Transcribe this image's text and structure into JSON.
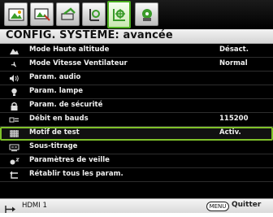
{
  "tabs": [
    {
      "icon": "image-tab-icon",
      "active": false
    },
    {
      "icon": "display-tab-icon",
      "active": false
    },
    {
      "icon": "settings-basic-tab-icon",
      "active": false
    },
    {
      "icon": "system-basic-tab-icon",
      "active": false
    },
    {
      "icon": "system-advanced-tab-icon",
      "active": true
    },
    {
      "icon": "information-tab-icon",
      "active": false
    }
  ],
  "header": {
    "title": "CONFIG. SYSTÈME: avancée"
  },
  "menu": {
    "items": [
      {
        "icon": "altitude-icon",
        "label": "Mode Haute altitude",
        "value": "Désact."
      },
      {
        "icon": "fan-icon",
        "label": "Mode Vitesse Ventilateur",
        "value": "Normal"
      },
      {
        "icon": "audio-icon",
        "label": "Param. audio",
        "value": ""
      },
      {
        "icon": "lamp-icon",
        "label": "Param. lampe",
        "value": ""
      },
      {
        "icon": "lock-icon",
        "label": "Param. de sécurité",
        "value": ""
      },
      {
        "icon": "baud-rate-icon",
        "label": "Débit en bauds",
        "value": "115200"
      },
      {
        "icon": "test-pattern-icon",
        "label": "Motif de test",
        "value": "Activ."
      },
      {
        "icon": "closed-caption-icon",
        "label": "Sous-titrage",
        "value": ""
      },
      {
        "icon": "standby-icon",
        "label": "Paramètres de veille",
        "value": ""
      },
      {
        "icon": "reset-icon",
        "label": "Rétablir tous les param.",
        "value": ""
      }
    ],
    "selected_index": 6
  },
  "footer": {
    "source_label": "HDMI 1",
    "menu_key": "MENU",
    "quit_label": "Quitter"
  },
  "colors": {
    "accent": "#7fc12a",
    "menu_bg": "#000000",
    "text": "#f0f0f0"
  }
}
